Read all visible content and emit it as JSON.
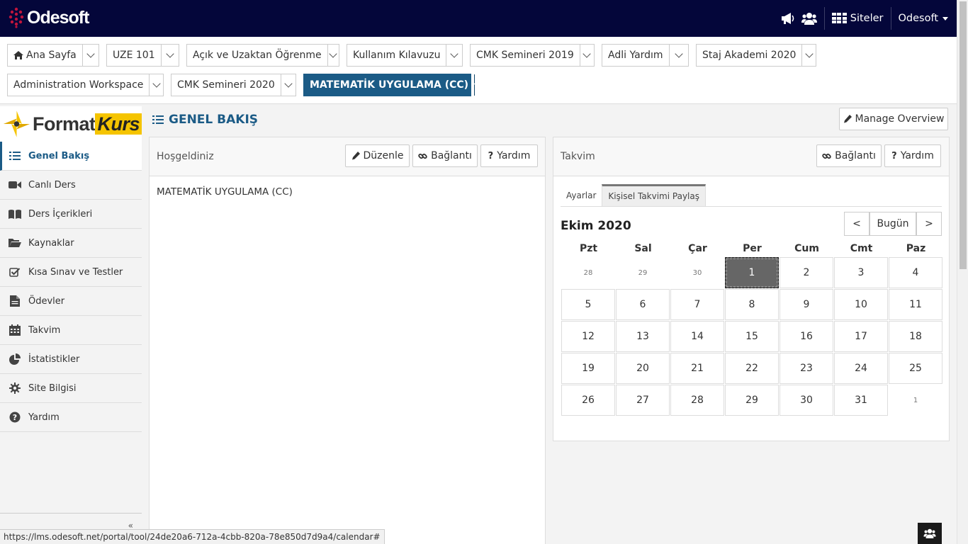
{
  "topbar": {
    "logo_text": "Odesoft",
    "siteler_label": "Siteler",
    "user_label": "Odesoft",
    "icons": [
      "megaphone-icon",
      "users-icon",
      "grid-icon"
    ]
  },
  "site_tabs": [
    {
      "label": "Ana Sayfa",
      "icon": "home-icon"
    },
    {
      "label": "UZE 101"
    },
    {
      "label": "Açık ve Uzaktan Öğrenme"
    },
    {
      "label": "Kullanım Kılavuzu"
    },
    {
      "label": "CMK Semineri 2019"
    },
    {
      "label": "Adli Yardım"
    },
    {
      "label": "Staj Akademi 2020"
    },
    {
      "label": "Administration Workspace"
    },
    {
      "label": "CMK Semineri 2020"
    },
    {
      "label": "MATEMATİK UYGULAMA (CC)",
      "active": true
    }
  ],
  "brand": {
    "part1": "Format",
    "part2": "Kurs"
  },
  "nav": {
    "items": [
      {
        "label": "Genel Bakış",
        "icon": "list-icon",
        "active": true
      },
      {
        "label": "Canlı Ders",
        "icon": "video-camera-icon"
      },
      {
        "label": "Ders İçerikleri",
        "icon": "book-icon"
      },
      {
        "label": "Kaynaklar",
        "icon": "folder-open-icon"
      },
      {
        "label": "Kısa Sınav ve Testler",
        "icon": "checkbox-icon"
      },
      {
        "label": "Ödevler",
        "icon": "document-icon"
      },
      {
        "label": "Takvim",
        "icon": "calendar-icon"
      },
      {
        "label": "İstatistikler",
        "icon": "pie-chart-icon"
      },
      {
        "label": "Site Bilgisi",
        "icon": "gear-icon"
      },
      {
        "label": "Yardım",
        "icon": "question-circle-icon"
      }
    ],
    "collapse_label": "«"
  },
  "main": {
    "title": "GENEL BAKIŞ",
    "manage_label": "Manage Overview"
  },
  "welcome": {
    "title": "Hoşgeldiniz",
    "edit_label": "Düzenle",
    "link_label": "Bağlantı",
    "help_label": "Yardım",
    "body": "MATEMATİK UYGULAMA (CC)"
  },
  "calendar": {
    "title": "Takvim",
    "link_label": "Bağlantı",
    "help_label": "Yardım",
    "tabs": [
      "Ayarlar",
      "Kişisel Takvimi Paylaş"
    ],
    "active_tab": 1,
    "month": "Ekim 2020",
    "prev_label": "<",
    "today_label": "Bugün",
    "next_label": ">",
    "weekdays": [
      "Pzt",
      "Sal",
      "Çar",
      "Per",
      "Cum",
      "Cmt",
      "Paz"
    ],
    "weeks": [
      [
        "28",
        "29",
        "30",
        "1",
        "2",
        "3",
        "4"
      ],
      [
        "5",
        "6",
        "7",
        "8",
        "9",
        "10",
        "11"
      ],
      [
        "12",
        "13",
        "14",
        "15",
        "16",
        "17",
        "18"
      ],
      [
        "19",
        "20",
        "21",
        "22",
        "23",
        "24",
        "25"
      ],
      [
        "26",
        "27",
        "28",
        "29",
        "30",
        "31",
        "1"
      ]
    ],
    "outside_month": [
      [
        0,
        0
      ],
      [
        0,
        1
      ],
      [
        0,
        2
      ],
      [
        4,
        6
      ]
    ],
    "today": [
      0,
      3
    ]
  },
  "status_url": "https://lms.odesoft.net/portal/tool/24de20a6-712a-4cbb-820a-78e850d7d9a4/calendar#"
}
